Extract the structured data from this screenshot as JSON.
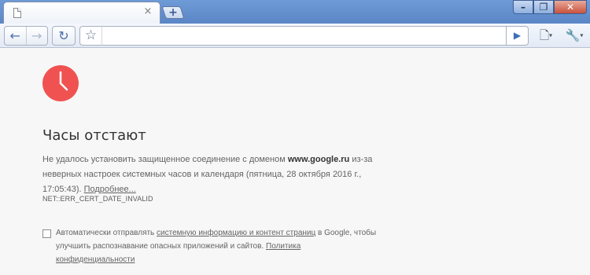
{
  "browser": {
    "tab": {
      "title": "",
      "close_glyph": "×",
      "icon": "page-icon"
    },
    "new_tab_glyph": "+",
    "window_buttons": {
      "minimize": "–",
      "restore": "❐",
      "close": "✕"
    },
    "toolbar": {
      "back_glyph": "←",
      "forward_glyph": "→",
      "reload_glyph": "↻",
      "star_glyph": "☆",
      "address_value": "",
      "go_glyph": "▶",
      "page_menu_glyph": "🗋",
      "wrench_glyph": "🔧",
      "menu_caret": "▾"
    }
  },
  "error_page": {
    "icon": "clock-icon",
    "icon_color": "#f05252",
    "heading": "Часы отстают",
    "message": {
      "part1": "Не удалось установить защищенное соединение с доменом ",
      "domain": "www.google.ru",
      "part2": " из-за неверных настроек системных часов и календаря (пятница, 28 октября 2016 г., 17:05:43). ",
      "details_link": "Подробнее..."
    },
    "error_code": "NET::ERR_CERT_DATE_INVALID",
    "optin": {
      "checked": false,
      "text1": "Автоматически отправлять ",
      "link1": "системную информацию и контент страниц",
      "text2": " в Google, чтобы улучшить распознавание опасных приложений и сайтов. ",
      "link2": "Политика конфиденциальности"
    }
  }
}
